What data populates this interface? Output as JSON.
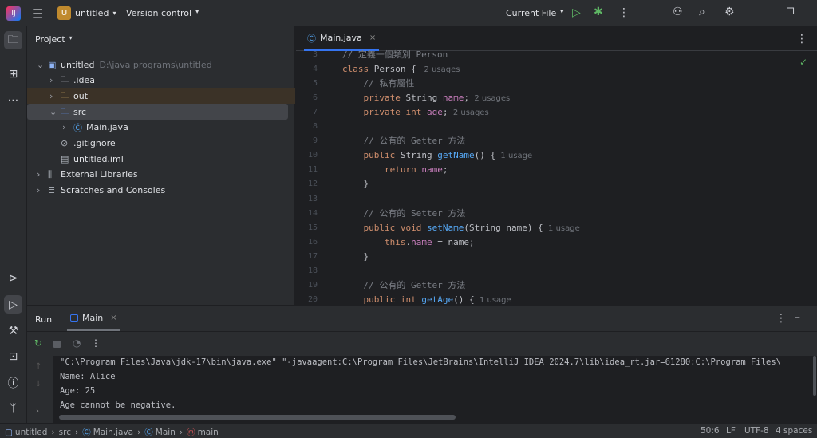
{
  "topbar": {
    "project_badge": "U",
    "project_name": "untitled",
    "vcs": "Version control",
    "run_config": "Current File"
  },
  "project_panel": {
    "title": "Project",
    "tree": [
      {
        "label": "untitled",
        "path": "D:\\java programs\\untitled",
        "icon": "module-folder-icon",
        "depth": 0,
        "expanded": true
      },
      {
        "label": ".idea",
        "icon": "folder-icon",
        "depth": 1,
        "expanded": false
      },
      {
        "label": "out",
        "icon": "folder-icon",
        "depth": 1,
        "expanded": false,
        "excluded": true
      },
      {
        "label": "src",
        "icon": "source-folder-icon",
        "depth": 1,
        "expanded": true,
        "selected": true
      },
      {
        "label": "Main.java",
        "icon": "java-class-icon",
        "depth": 2,
        "expanded": false
      },
      {
        "label": ".gitignore",
        "icon": "gitignore-file-icon",
        "depth": 1,
        "leaf": true
      },
      {
        "label": "untitled.iml",
        "icon": "iml-file-icon",
        "depth": 1,
        "leaf": true
      },
      {
        "label": "External Libraries",
        "icon": "library-icon",
        "depth": 0,
        "expanded": false
      },
      {
        "label": "Scratches and Consoles",
        "icon": "scratches-icon",
        "depth": 0,
        "expanded": false
      }
    ]
  },
  "editor": {
    "tab": "Main.java",
    "lines": [
      {
        "n": "3",
        "t": [
          [
            "cm",
            "// 定義一個類別 Person"
          ]
        ]
      },
      {
        "n": "4",
        "t": [
          [
            "kw",
            "class "
          ],
          [
            "tx",
            "Person { "
          ],
          [
            "hint",
            " 2 usages"
          ]
        ]
      },
      {
        "n": "5",
        "t": [
          [
            "tx",
            "    "
          ],
          [
            "cm",
            "// 私有屬性"
          ]
        ]
      },
      {
        "n": "6",
        "t": [
          [
            "tx",
            "    "
          ],
          [
            "kw",
            "private "
          ],
          [
            "tx",
            "String "
          ],
          [
            "fd",
            "name"
          ],
          [
            "tx",
            ";"
          ],
          [
            "hint",
            "  2 usages"
          ]
        ]
      },
      {
        "n": "7",
        "t": [
          [
            "tx",
            "    "
          ],
          [
            "kw",
            "private int "
          ],
          [
            "fd",
            "age"
          ],
          [
            "tx",
            ";"
          ],
          [
            "hint",
            "  2 usages"
          ]
        ]
      },
      {
        "n": "8",
        "t": []
      },
      {
        "n": "9",
        "t": [
          [
            "tx",
            "    "
          ],
          [
            "cm",
            "// 公有的 Getter 方法"
          ]
        ]
      },
      {
        "n": "10",
        "t": [
          [
            "tx",
            "    "
          ],
          [
            "kw",
            "public "
          ],
          [
            "tx",
            "String "
          ],
          [
            "fn",
            "getName"
          ],
          [
            "tx",
            "() {"
          ],
          [
            "hint",
            "  1 usage"
          ]
        ]
      },
      {
        "n": "11",
        "t": [
          [
            "tx",
            "        "
          ],
          [
            "kw",
            "return "
          ],
          [
            "fd",
            "name"
          ],
          [
            "tx",
            ";"
          ]
        ]
      },
      {
        "n": "12",
        "t": [
          [
            "tx",
            "    }"
          ]
        ]
      },
      {
        "n": "13",
        "t": []
      },
      {
        "n": "14",
        "t": [
          [
            "tx",
            "    "
          ],
          [
            "cm",
            "// 公有的 Setter 方法"
          ]
        ]
      },
      {
        "n": "15",
        "t": [
          [
            "tx",
            "    "
          ],
          [
            "kw",
            "public void "
          ],
          [
            "fn",
            "setName"
          ],
          [
            "tx",
            "(String name) {"
          ],
          [
            "hint",
            "  1 usage"
          ]
        ]
      },
      {
        "n": "16",
        "t": [
          [
            "tx",
            "        "
          ],
          [
            "kw",
            "this"
          ],
          [
            "tx",
            "."
          ],
          [
            "fd",
            "name"
          ],
          [
            "tx",
            " = name;"
          ]
        ]
      },
      {
        "n": "17",
        "t": [
          [
            "tx",
            "    }"
          ]
        ]
      },
      {
        "n": "18",
        "t": []
      },
      {
        "n": "19",
        "t": [
          [
            "tx",
            "    "
          ],
          [
            "cm",
            "// 公有的 Getter 方法"
          ]
        ]
      },
      {
        "n": "20",
        "t": [
          [
            "tx",
            "    "
          ],
          [
            "kw",
            "public int "
          ],
          [
            "fn",
            "getAge"
          ],
          [
            "tx",
            "() {"
          ],
          [
            "hint",
            "  1 usage"
          ]
        ]
      }
    ]
  },
  "run": {
    "title": "Run",
    "tab": "Main",
    "console": [
      "\"C:\\Program Files\\Java\\jdk-17\\bin\\java.exe\" \"-javaagent:C:\\Program Files\\JetBrains\\IntelliJ IDEA 2024.7\\lib\\idea_rt.jar=61280:C:\\Program Files\\",
      "Name: Alice",
      "Age: 25",
      "Age cannot be negative."
    ]
  },
  "status": {
    "breadcrumb": [
      "untitled",
      "src",
      "Main.java",
      "Main",
      "main"
    ],
    "position": "50:6",
    "line_sep": "LF",
    "encoding": "UTF-8",
    "indent": "4 spaces"
  },
  "colors": {
    "accent": "#3574f0",
    "keyword": "#cf8e6d",
    "function": "#56a8f5",
    "field": "#c77dbb",
    "comment": "#7a7e85",
    "run_green": "#5fb865"
  }
}
